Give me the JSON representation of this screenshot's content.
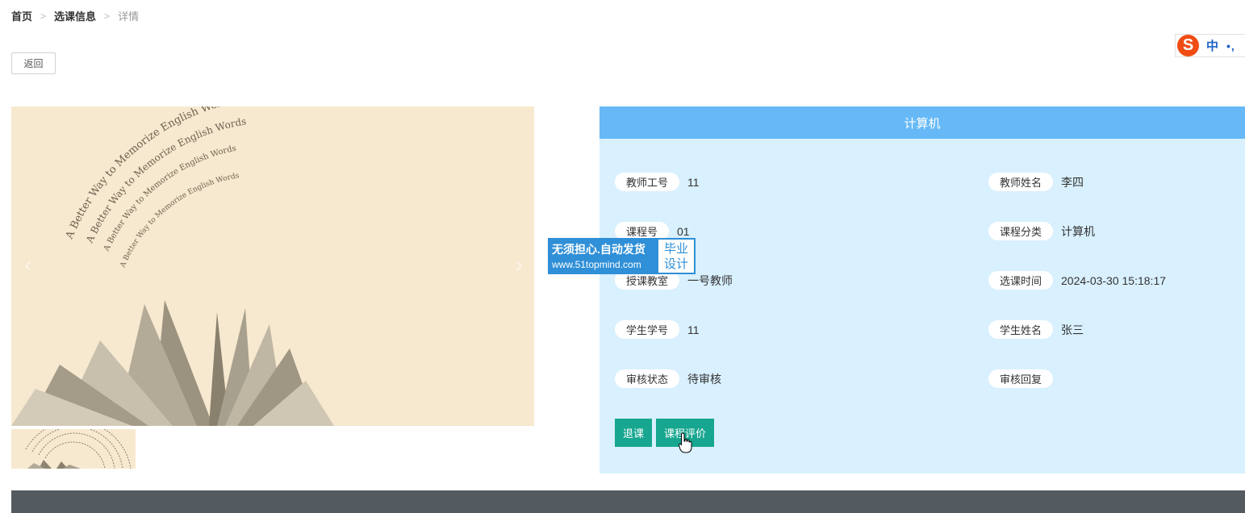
{
  "breadcrumb": {
    "home": "首页",
    "sep1": ">",
    "section": "选课信息",
    "sep2": ">",
    "current": "详情"
  },
  "back_button": "返回",
  "ime": {
    "logo": "S",
    "mode": "中",
    "punct": "•,"
  },
  "gallery": {
    "arrow_prev": "‹",
    "arrow_next": "›",
    "image_title": "A Better Way to Memorize English Words"
  },
  "watermark": {
    "line1": "无须担心.自动发货",
    "line2": "www.51topmind.com",
    "badge_top": "毕业",
    "badge_bottom": "设计"
  },
  "detail": {
    "title": "计算机",
    "fields": {
      "teacher_id": {
        "label": "教师工号",
        "value": "11"
      },
      "teacher_name": {
        "label": "教师姓名",
        "value": "李四"
      },
      "course_no": {
        "label": "课程号",
        "value": "01"
      },
      "course_category": {
        "label": "课程分类",
        "value": "计算机"
      },
      "classroom": {
        "label": "授课教室",
        "value": "一号教师"
      },
      "select_time": {
        "label": "选课时间",
        "value": "2024-03-30 15:18:17"
      },
      "student_id": {
        "label": "学生学号",
        "value": "11"
      },
      "student_name": {
        "label": "学生姓名",
        "value": "张三"
      },
      "review_status": {
        "label": "审核状态",
        "value": "待审核"
      },
      "review_reply": {
        "label": "审核回复",
        "value": ""
      }
    },
    "actions": {
      "drop_course": "退课",
      "evaluate_course": "课程评价"
    }
  },
  "colors": {
    "panel_header": "#66b9f6",
    "panel_bg": "#d9f0fe",
    "action_button": "#17a68f",
    "footer": "#535b61"
  }
}
